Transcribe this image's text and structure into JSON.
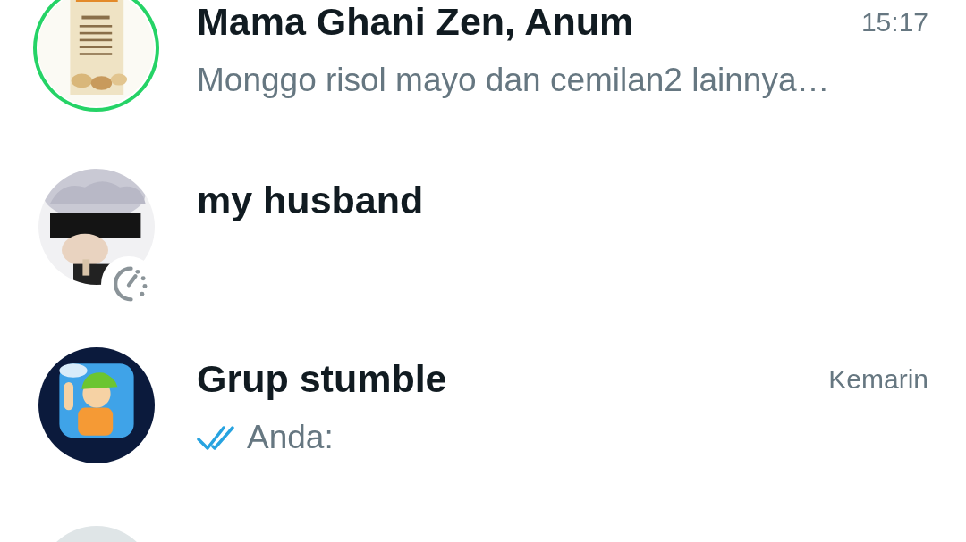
{
  "chats": [
    {
      "avatar": {
        "kind": "picture",
        "status_ring": true
      },
      "name": "Mama Ghani Zen, Anum",
      "time": "15:17",
      "preview": "Monggo risol mayo dan cemilan2 lainnya…"
    },
    {
      "avatar": {
        "kind": "picture",
        "disappearing": true
      },
      "name": "my husband"
    },
    {
      "avatar": {
        "kind": "picture"
      },
      "name": "Grup stumble",
      "time": "Kemarin",
      "preview": "Anda:",
      "read_ticks": true
    },
    {
      "avatar": {
        "kind": "default"
      }
    }
  ]
}
